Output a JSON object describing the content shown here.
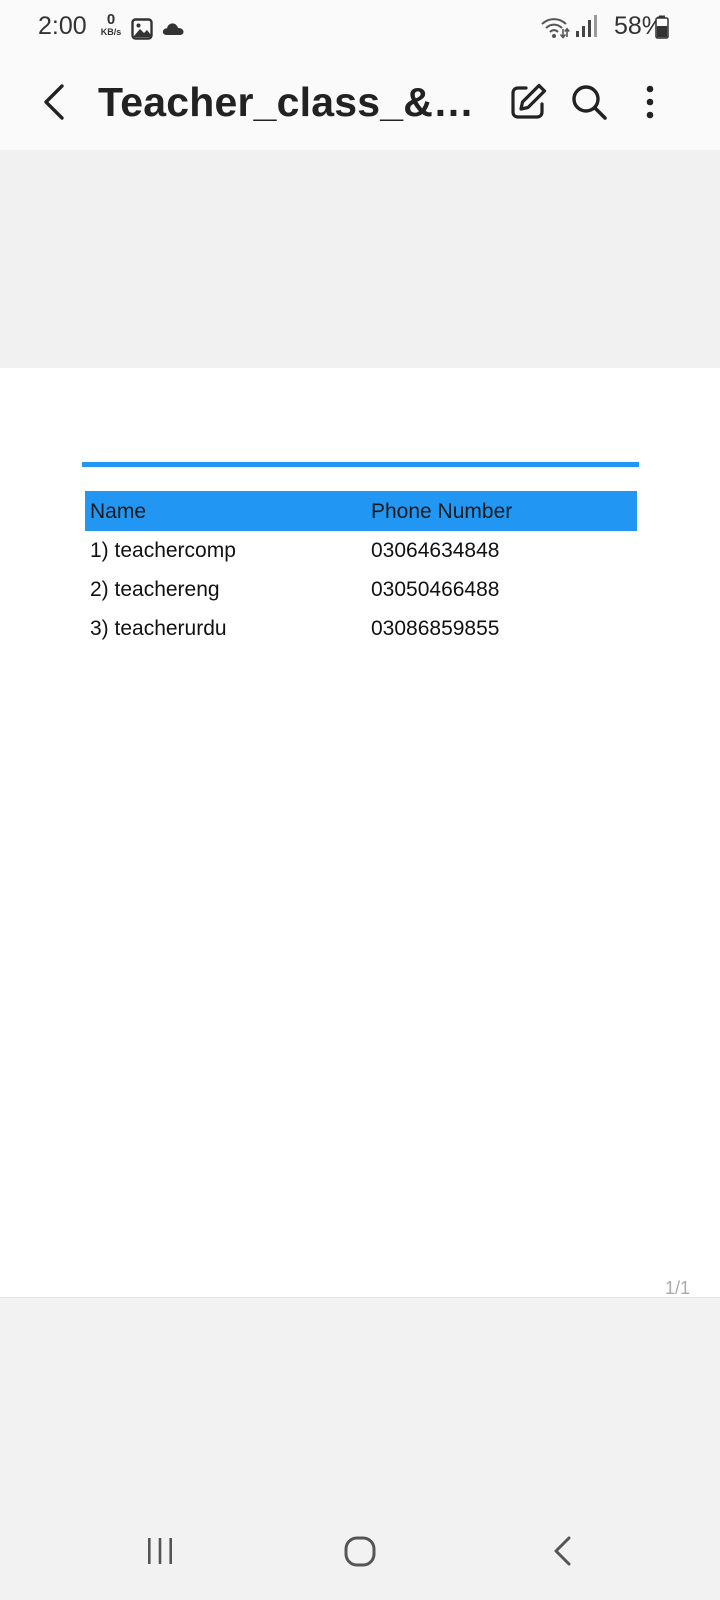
{
  "status_bar": {
    "time": "2:00",
    "net_speed_value": "0",
    "net_speed_unit": "KB/s",
    "icons": [
      "gallery-notification-icon",
      "cloud-icon",
      "wifi-icon",
      "signal-icon",
      "battery-icon"
    ],
    "battery_percent": "58%"
  },
  "app_bar": {
    "title": "Teacher_class_&_su...",
    "back_icon": "chevron-left-icon",
    "actions": [
      "edit-icon",
      "search-icon",
      "more-vert-icon"
    ]
  },
  "document": {
    "accent_color": "#2196f3",
    "table": {
      "headers": [
        "Name",
        "Phone Number"
      ],
      "rows": [
        [
          "1) teachercomp",
          "03064634848"
        ],
        [
          "2) teachereng",
          "03050466488"
        ],
        [
          "3) teacherurdu",
          "03086859855"
        ]
      ]
    },
    "page_indicator": "1/1"
  },
  "nav_bar": {
    "buttons": [
      "recent-apps-icon",
      "home-icon",
      "back-icon"
    ]
  }
}
